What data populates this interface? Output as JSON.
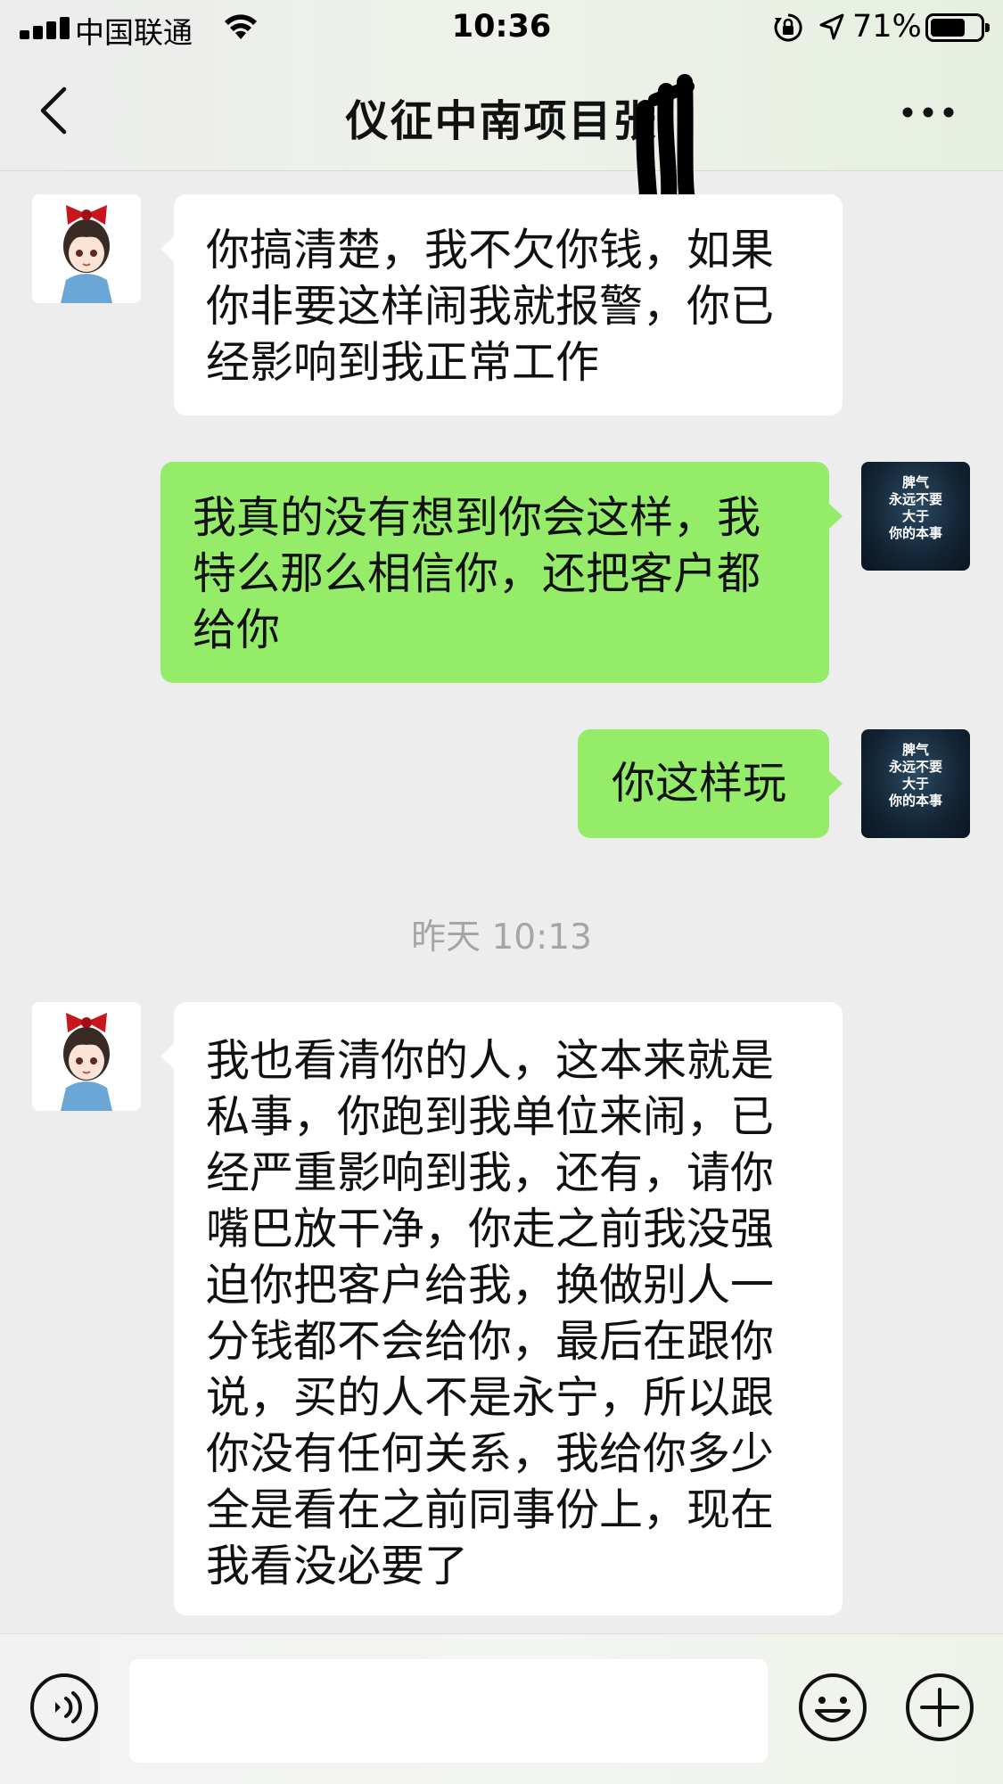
{
  "status_bar": {
    "carrier": "中国联通",
    "time": "10:36",
    "battery_pct": "71%",
    "battery_level": 0.71,
    "icons": [
      "signal-icon",
      "wifi-icon",
      "orientation-lock-icon",
      "location-arrow-icon",
      "battery-icon"
    ]
  },
  "nav": {
    "title": "仪征中南项目张",
    "back_icon": "chevron-left-icon",
    "more_icon": "more-dots-icon"
  },
  "messages": [
    {
      "side": "left",
      "sender_avatar": "girl-avatar",
      "lines": [
        "你搞清楚，我不欠你钱，如果",
        "你非要这样闹我就报警，你已",
        "经影响到我正常工作"
      ]
    },
    {
      "side": "right",
      "sender_avatar": "quote-avatar",
      "lines": [
        "我真的没有想到你会这样，我",
        "特么那么相信你，还把客户都",
        "给你"
      ]
    },
    {
      "side": "right",
      "sender_avatar": "quote-avatar",
      "lines": [
        "你这样玩"
      ]
    },
    {
      "side": "left",
      "sender_avatar": "girl-avatar",
      "lines": [
        "我也看清你的人，这本来就是",
        "私事，你跑到我单位来闹，已",
        "经严重影响到我，还有，请你",
        "嘴巴放干净，你走之前我没强",
        "迫你把客户给我，换做别人一",
        "分钱都不会给你，最后在跟你",
        "说，买的人不是永宁，所以跟",
        "你没有任何关系，我给你多少",
        "全是看在之前同事份上，现在",
        "我看没必要了"
      ]
    }
  ],
  "timestamp": "昨天 10:13",
  "quote_avatar_text": [
    "脾气",
    "永远不要",
    "大于",
    "你的本事"
  ],
  "input_bar": {
    "voice_icon": "voice-icon",
    "emoji_icon": "emoji-icon",
    "plus_icon": "plus-icon",
    "input_value": ""
  },
  "colors": {
    "background": "#ededed",
    "bubble_self": "#95ec69",
    "bubble_other": "#ffffff",
    "timestamp": "#a6a6a6"
  }
}
